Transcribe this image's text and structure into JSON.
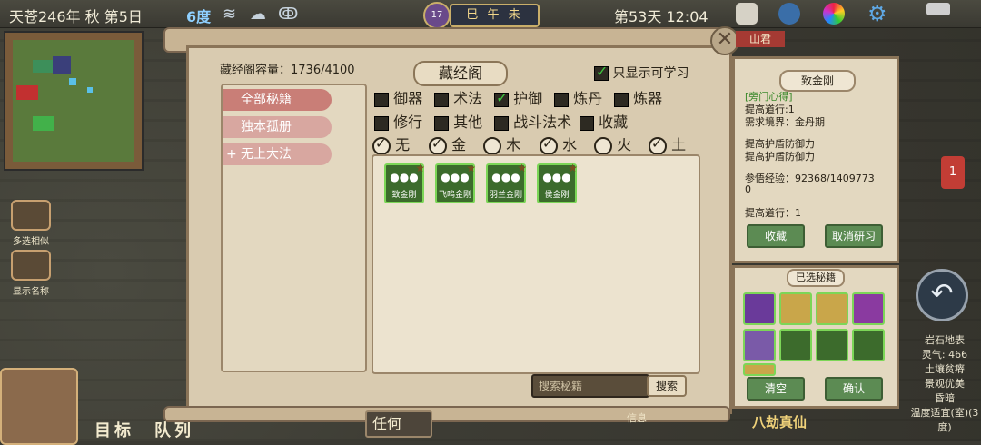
{
  "status_bar": {
    "date": "天苍246年 秋 第5日",
    "temperature": "6度",
    "ganzhi": "巳 午 未",
    "moon_day": "17",
    "time": "第53天 12:04",
    "icons": [
      "wind-icon",
      "cloud-icon",
      "swirl-icon",
      "save-icon",
      "compass-icon",
      "palette-icon",
      "gear-icon",
      "toggle-icon"
    ]
  },
  "left_side": {
    "btn_multi_select": "多选相似",
    "btn_show_names": "显示名称",
    "btn_target": "目标",
    "btn_team": "队列"
  },
  "panel": {
    "title": "藏经阁",
    "capacity": "藏经阁容量：1736/4100",
    "only_learnable": "只显示可学习",
    "tabs": [
      {
        "label": "全部秘籍",
        "color": "#c97e77"
      },
      {
        "label": "独本孤册",
        "color": "#d8a7a0"
      },
      {
        "label": "无上大法",
        "color": "#d8a7a0"
      }
    ],
    "categories": [
      {
        "label": "御器",
        "checked": false
      },
      {
        "label": "术法",
        "checked": false
      },
      {
        "label": "护御",
        "checked": true
      },
      {
        "label": "炼丹",
        "checked": false
      },
      {
        "label": "炼器",
        "checked": false
      },
      {
        "label": "修行",
        "checked": false
      },
      {
        "label": "其他",
        "checked": false
      },
      {
        "label": "战斗法术",
        "checked": false
      },
      {
        "label": "收藏",
        "checked": false
      }
    ],
    "elements": [
      {
        "label": "无",
        "checked": true
      },
      {
        "label": "金",
        "checked": true
      },
      {
        "label": "木",
        "checked": false
      },
      {
        "label": "水",
        "checked": true
      },
      {
        "label": "火",
        "checked": false
      },
      {
        "label": "土",
        "checked": true
      }
    ],
    "books": [
      {
        "label": "致金刚"
      },
      {
        "label": "飞鸣金刚"
      },
      {
        "label": "羽兰金刚"
      },
      {
        "label": "侯金刚"
      }
    ],
    "search_placeholder": "搜索秘籍",
    "search_button": "搜索"
  },
  "detail": {
    "title": "致金刚",
    "lines": [
      "[旁门心得]",
      "提高道行:1",
      "需求境界：金丹期",
      "",
      "提高护盾防御力",
      "提高护盾防御力",
      "",
      "参悟经验：92368/1409773",
      "0",
      "",
      "提高道行：1"
    ],
    "btn_collect": "收藏",
    "btn_cancel_research": "取消研习"
  },
  "selected": {
    "title": "已选秘籍",
    "btn_clear": "清空",
    "btn_confirm": "确认"
  },
  "right_info": [
    "岩石地表",
    "灵气: 466",
    "土壤贫瘠",
    "景观优美",
    "昏暗",
    "温度适宜(室)(3度)"
  ],
  "misc": {
    "mountain_tag": "山君",
    "badge_count": "1",
    "bajie": "八劫真仙",
    "renhe": "任何",
    "xinxi": "信息"
  }
}
